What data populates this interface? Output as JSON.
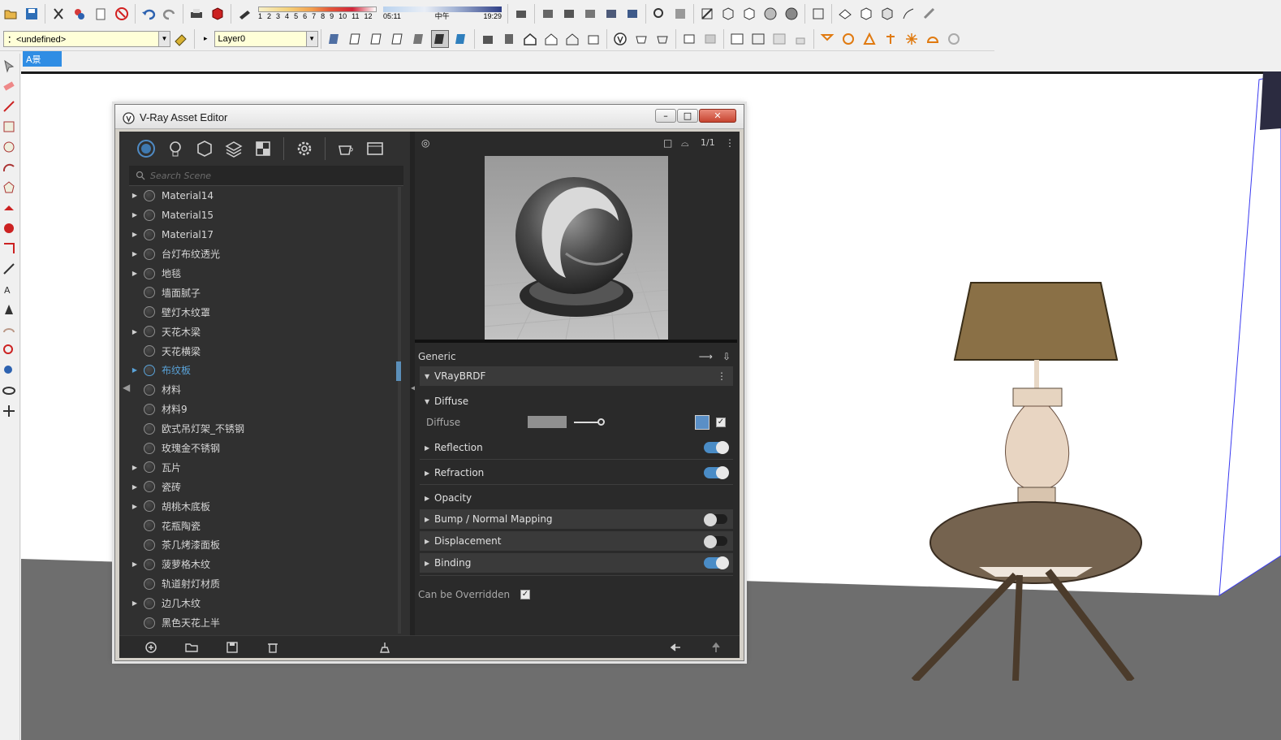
{
  "toolbar": {
    "legend_numbers": [
      "1",
      "2",
      "3",
      "4",
      "5",
      "6",
      "7",
      "8",
      "9",
      "10",
      "11",
      "12"
    ],
    "time_start": "05:11",
    "time_mid": "中午",
    "time_end": "19:29"
  },
  "tag_selector": {
    "label": "：<undefined>"
  },
  "layer_selector": {
    "label": "Layer0"
  },
  "scene_tab": {
    "label": "A景"
  },
  "window": {
    "title": "V-Ray Asset Editor",
    "close_label": "✕",
    "min_label": "–",
    "max_label": "□"
  },
  "asset_editor": {
    "search_placeholder": "Search Scene",
    "materials": [
      {
        "name": "Material14",
        "expandable": true
      },
      {
        "name": "Material15",
        "expandable": true
      },
      {
        "name": "Material17",
        "expandable": true
      },
      {
        "name": "台灯布纹透光",
        "expandable": true
      },
      {
        "name": "地毯",
        "expandable": true
      },
      {
        "name": "墙面腻子",
        "expandable": false
      },
      {
        "name": "壁灯木纹罩",
        "expandable": false
      },
      {
        "name": "天花木梁",
        "expandable": true
      },
      {
        "name": "天花横梁",
        "expandable": false
      },
      {
        "name": "布纹板",
        "expandable": true,
        "selected": true
      },
      {
        "name": "材料",
        "expandable": false
      },
      {
        "name": "材料9",
        "expandable": false
      },
      {
        "name": "欧式吊灯架_不锈钢",
        "expandable": false
      },
      {
        "name": "玫瑰金不锈钢",
        "expandable": false
      },
      {
        "name": "瓦片",
        "expandable": true
      },
      {
        "name": "瓷砖",
        "expandable": true
      },
      {
        "name": "胡桃木底板",
        "expandable": true
      },
      {
        "name": "花瓶陶瓷",
        "expandable": false
      },
      {
        "name": "茶几烤漆面板",
        "expandable": false
      },
      {
        "name": "菠萝格木纹",
        "expandable": true
      },
      {
        "name": "轨道射灯材质",
        "expandable": false
      },
      {
        "name": "边几木纹",
        "expandable": true
      },
      {
        "name": "黑色天花上半",
        "expandable": false
      }
    ],
    "preview_scale": "1/1",
    "properties": {
      "generic_label": "Generic",
      "brdf_label": "VRayBRDF",
      "diffuse_section": "Diffuse",
      "diffuse_prop": "Diffuse",
      "diffuse_color": "#8f8f8f",
      "sections": [
        {
          "label": "Reflection",
          "toggle": "on"
        },
        {
          "label": "Refraction",
          "toggle": "on"
        },
        {
          "label": "Opacity",
          "toggle": null
        },
        {
          "label": "Bump / Normal Mapping",
          "toggle": "off"
        },
        {
          "label": "Displacement",
          "toggle": "off"
        },
        {
          "label": "Binding",
          "toggle": "on"
        }
      ],
      "override_label": "Can be Overridden",
      "override_checked": true
    }
  },
  "colors": {
    "accent_blue": "#4a8cc6",
    "selection_blue": "#5aa3d9",
    "panel_bg": "#2b2b2b"
  }
}
